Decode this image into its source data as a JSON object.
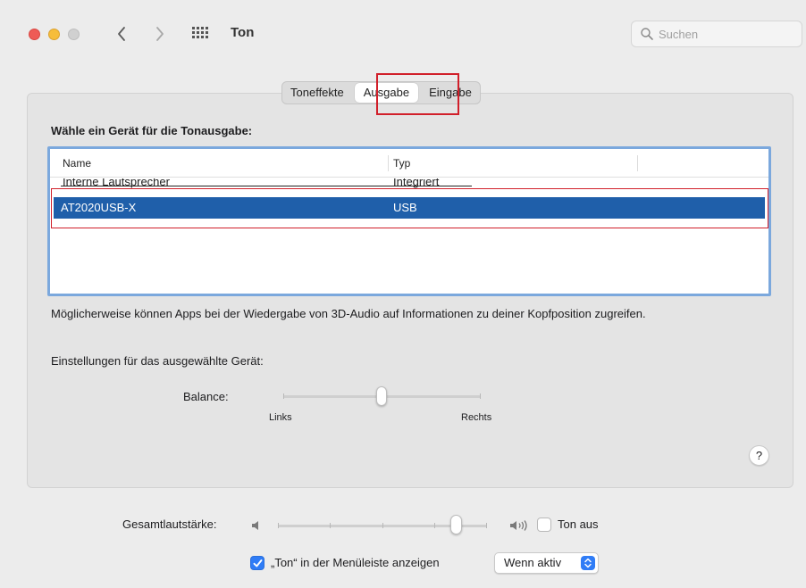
{
  "window": {
    "title": "Ton",
    "search_placeholder": "Suchen",
    "traffic_lights": {
      "close": "#ee5b56",
      "minimize": "#f6bd3b",
      "zoom": "#d0d0d0"
    }
  },
  "toolbar": {
    "back_icon": "chevron-left",
    "forward_icon": "chevron-right",
    "all_prefs_icon": "grid-icon"
  },
  "tabs": [
    {
      "label": "Toneffekte",
      "active": false
    },
    {
      "label": "Ausgabe",
      "active": true
    },
    {
      "label": "Eingabe",
      "active": false
    }
  ],
  "output": {
    "section_title": "Wähle ein Gerät für die Tonausgabe:",
    "columns": {
      "name": "Name",
      "type": "Typ"
    },
    "devices": [
      {
        "name": "Interne Lautsprecher",
        "type": "Integriert",
        "selected": false
      },
      {
        "name": "AT2020USB-X",
        "type": "USB",
        "selected": true
      }
    ],
    "info_text": "Möglicherweise können Apps bei der Wiedergabe von 3D-Audio auf Informationen zu deiner Kopfposition zugreifen.",
    "settings_label": "Einstellungen für das ausgewählte Gerät:",
    "balance": {
      "label": "Balance:",
      "left_label": "Links",
      "right_label": "Rechts",
      "value": 0.5
    },
    "help_label": "?"
  },
  "footer": {
    "volume_label": "Gesamtlautstärke:",
    "volume_value": 0.84,
    "mute_label": "Ton aus",
    "mute_checked": false,
    "menubar_label": "„Ton“ in der Menüleiste anzeigen",
    "menubar_checked": true,
    "menubar_option": "Wenn aktiv"
  },
  "colors": {
    "selection": "#1f5faa",
    "table_focus_ring": "#7ba8dd",
    "accent": "#2f7cf6",
    "highlight_annotation": "#d11f2a"
  }
}
